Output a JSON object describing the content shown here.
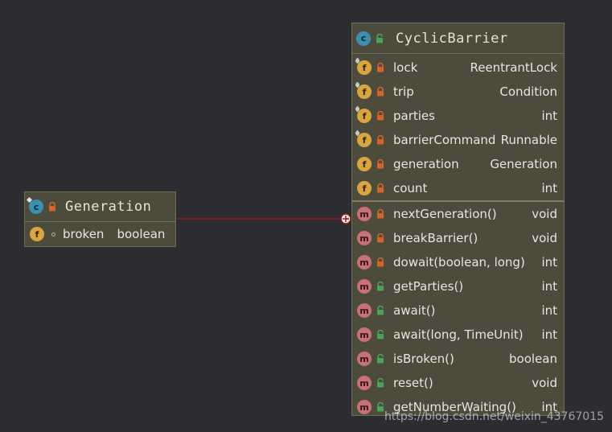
{
  "generation": {
    "title": "Generation",
    "fields": [
      {
        "name": "broken",
        "type": "boolean",
        "icon": "field-icon",
        "visibility": "package-private"
      }
    ]
  },
  "cyclic_barrier": {
    "title": "CyclicBarrier",
    "fields": [
      {
        "name": "lock",
        "type": "ReentrantLock",
        "visibility": "private",
        "final": true
      },
      {
        "name": "trip",
        "type": "Condition",
        "visibility": "private",
        "final": true
      },
      {
        "name": "parties",
        "type": "int",
        "visibility": "private",
        "final": true
      },
      {
        "name": "barrierCommand",
        "type": "Runnable",
        "visibility": "private",
        "final": true
      },
      {
        "name": "generation",
        "type": "Generation",
        "visibility": "private",
        "final": false
      },
      {
        "name": "count",
        "type": "int",
        "visibility": "private",
        "final": false
      }
    ],
    "methods": [
      {
        "name": "nextGeneration()",
        "type": "void",
        "visibility": "private"
      },
      {
        "name": "breakBarrier()",
        "type": "void",
        "visibility": "private"
      },
      {
        "name": "dowait(boolean, long)",
        "type": "int",
        "visibility": "private"
      },
      {
        "name": "getParties()",
        "type": "int",
        "visibility": "public"
      },
      {
        "name": "await()",
        "type": "int",
        "visibility": "public"
      },
      {
        "name": "await(long, TimeUnit)",
        "type": "int",
        "visibility": "public"
      },
      {
        "name": "isBroken()",
        "type": "boolean",
        "visibility": "public"
      },
      {
        "name": "reset()",
        "type": "void",
        "visibility": "public"
      },
      {
        "name": "getNumberWaiting()",
        "type": "int",
        "visibility": "public"
      }
    ]
  },
  "watermark": "https://blog.csdn.net/weixin_43767015",
  "colors": {
    "background": "#2b2d30",
    "class_fill": "#4d4b3c",
    "connector": "#8a1f1f",
    "lock_private": "#d4642b",
    "lock_public": "#4aa35a"
  }
}
